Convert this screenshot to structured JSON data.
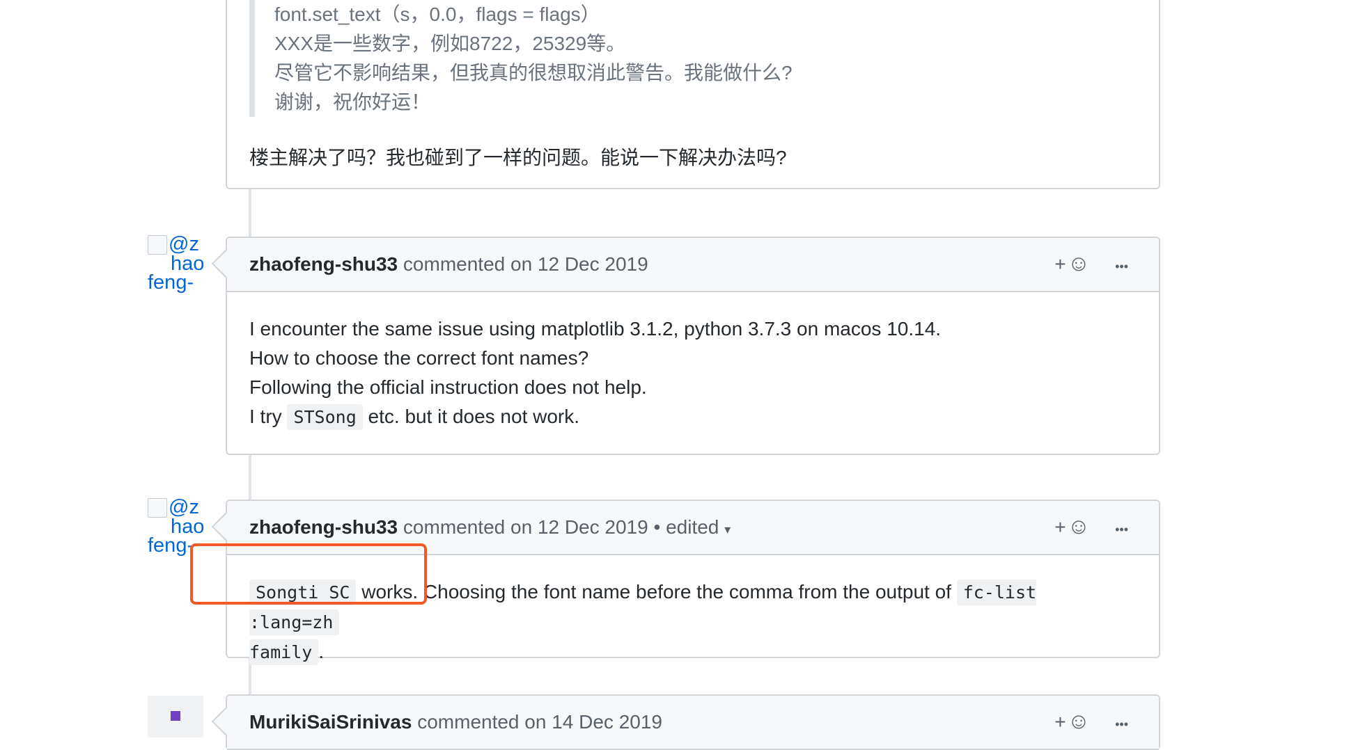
{
  "top_comment": {
    "quote_lines": [
      "font.set_text（s，0.0，flags = flags）",
      "XXX是一些数字，例如8722，25329等。",
      "尽管它不影响结果，但我真的很想取消此警告。我能做什么?",
      "谢谢，祝你好运！"
    ],
    "reply": "楼主解决了吗？我也碰到了一样的问题。能说一下解决办法吗?"
  },
  "avatar_alt": [
    "@z",
    "hao",
    "feng-"
  ],
  "comment1": {
    "author": "zhaofeng-shu33",
    "meta": "commented on 12 Dec 2019",
    "lines": [
      "I encounter the same issue using matplotlib 3.1.2, python 3.7.3 on macos 10.14.",
      "How to choose the correct font names?",
      "Following the official instruction does not help."
    ],
    "last_prefix": "I try",
    "last_code": "STSong",
    "last_suffix": "etc. but it does not work."
  },
  "comment2": {
    "author": "zhaofeng-shu33",
    "meta": "commented on 12 Dec 2019",
    "edited": "• edited",
    "code1": "Songti SC",
    "text1": "works. Choosing the font name before the comma from the output of",
    "code2": "fc-list :lang=zh",
    "code3": "family",
    "text2": "."
  },
  "comment3": {
    "author": "MurikiSaiSrinivas",
    "meta": "commented on 14 Dec 2019"
  },
  "actions": {
    "add": "+",
    "emoji": "☺",
    "more": "•••"
  },
  "colors": {
    "highlight": "#f05a28",
    "link": "#0366d6"
  }
}
